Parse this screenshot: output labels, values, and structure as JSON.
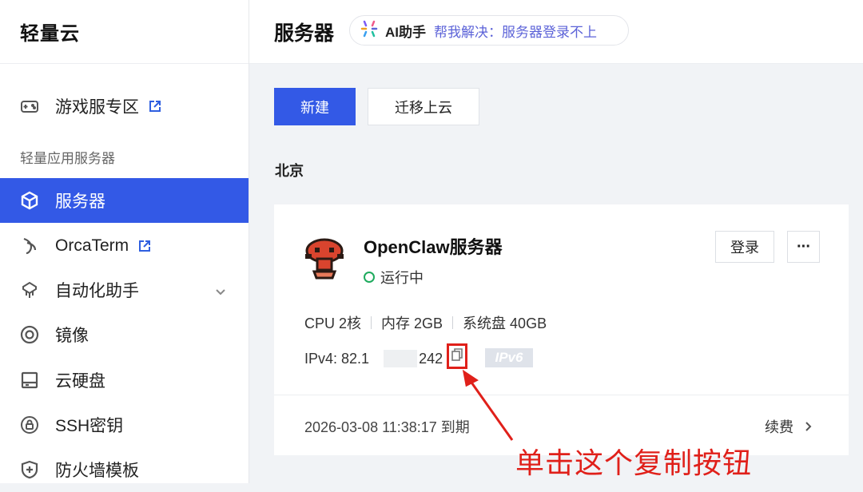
{
  "brand": "轻量云",
  "sidebar": {
    "section_label": "轻量应用服务器",
    "items": [
      {
        "label": "游戏服专区",
        "icon": "gamepad-icon",
        "external": true
      },
      {
        "label": "服务器",
        "icon": "cube-icon",
        "active": true
      },
      {
        "label": "OrcaTerm",
        "icon": "orca-icon",
        "external": true
      },
      {
        "label": "自动化助手",
        "icon": "robot-icon",
        "expandable": true
      },
      {
        "label": "镜像",
        "icon": "disc-icon"
      },
      {
        "label": "云硬盘",
        "icon": "drive-icon"
      },
      {
        "label": "SSH密钥",
        "icon": "key-lock-icon"
      },
      {
        "label": "防火墙模板",
        "icon": "shield-icon"
      }
    ]
  },
  "header": {
    "title": "服务器",
    "ai_assistant": {
      "name": "AI助手",
      "hint": "帮我解决：服务器登录不上"
    }
  },
  "toolbar": {
    "new_label": "新建",
    "migrate_label": "迁移上云"
  },
  "region": "北京",
  "server_card": {
    "name": "OpenClaw服务器",
    "status": "运行中",
    "login_label": "登录",
    "more_label": "···",
    "specs": [
      "CPU 2核",
      "内存 2GB",
      "系统盘 40GB"
    ],
    "ipv4_prefix": "IPv4: 82.1",
    "ipv4_suffix": "242",
    "ipv6_badge": "IPv6",
    "expire_text": "2026-03-08 11:38:17 到期",
    "renew_label": "续费"
  },
  "annotation": "单击这个复制按钮",
  "colors": {
    "accent": "#3359e6",
    "annotation_red": "#e0201a",
    "running_green": "#1fab5e"
  }
}
